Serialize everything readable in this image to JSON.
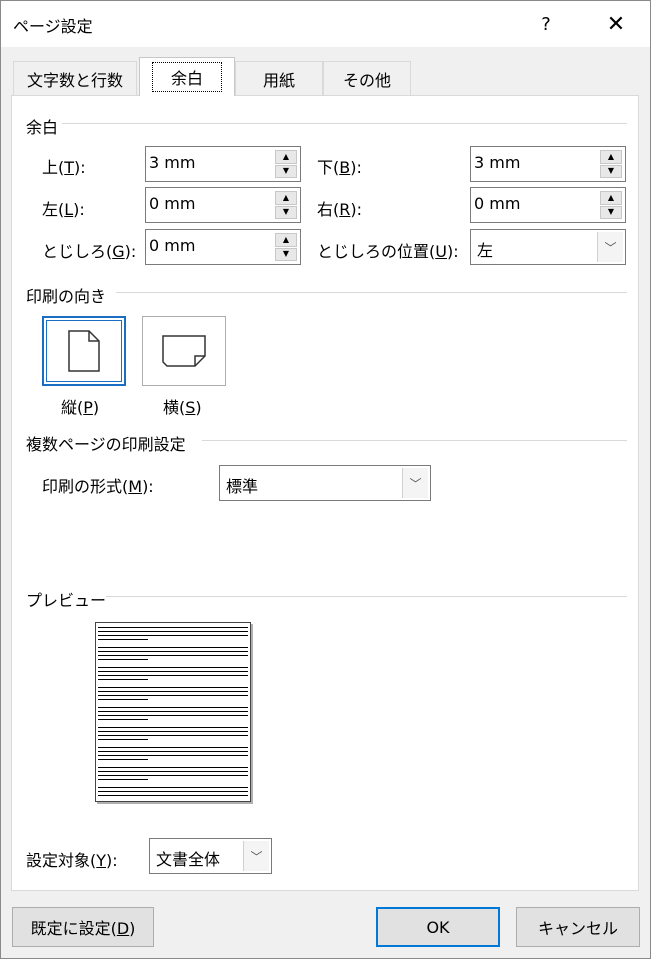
{
  "window": {
    "title": "ページ設定",
    "help_label": "?",
    "close_label": "✕"
  },
  "tabs": [
    {
      "label": "文字数と行数"
    },
    {
      "label": "余白"
    },
    {
      "label": "用紙"
    },
    {
      "label": "その他"
    }
  ],
  "margins": {
    "section_label": "余白",
    "top": {
      "prefix": "上(",
      "key": "T",
      "suffix": "):",
      "value": "3 mm"
    },
    "bottom": {
      "prefix": "下(",
      "key": "B",
      "suffix": "):",
      "value": "3 mm"
    },
    "left": {
      "prefix": "左(",
      "key": "L",
      "suffix": "):",
      "value": "0 mm"
    },
    "right": {
      "prefix": "右(",
      "key": "R",
      "suffix": "):",
      "value": "0 mm"
    },
    "gutter": {
      "prefix": "とじしろ(",
      "key": "G",
      "suffix": "):",
      "value": "0 mm"
    },
    "gutter_position": {
      "prefix": "とじしろの位置(",
      "key": "U",
      "suffix": "):",
      "value": "左"
    }
  },
  "orientation": {
    "section_label": "印刷の向き",
    "portrait": {
      "prefix": "縦(",
      "key": "P",
      "suffix": ")"
    },
    "landscape": {
      "prefix": "横(",
      "key": "S",
      "suffix": ")"
    }
  },
  "pages": {
    "section_label": "複数ページの印刷設定",
    "format": {
      "prefix": "印刷の形式(",
      "key": "M",
      "suffix": "):",
      "value": "標準"
    }
  },
  "preview": {
    "section_label": "プレビュー"
  },
  "apply_to": {
    "prefix": "設定対象(",
    "key": "Y",
    "suffix": "):",
    "value": "文書全体"
  },
  "footer": {
    "default_prefix": "既定に設定(",
    "default_key": "D",
    "default_suffix": ")",
    "ok_label": "OK",
    "cancel_label": "キャンセル"
  }
}
